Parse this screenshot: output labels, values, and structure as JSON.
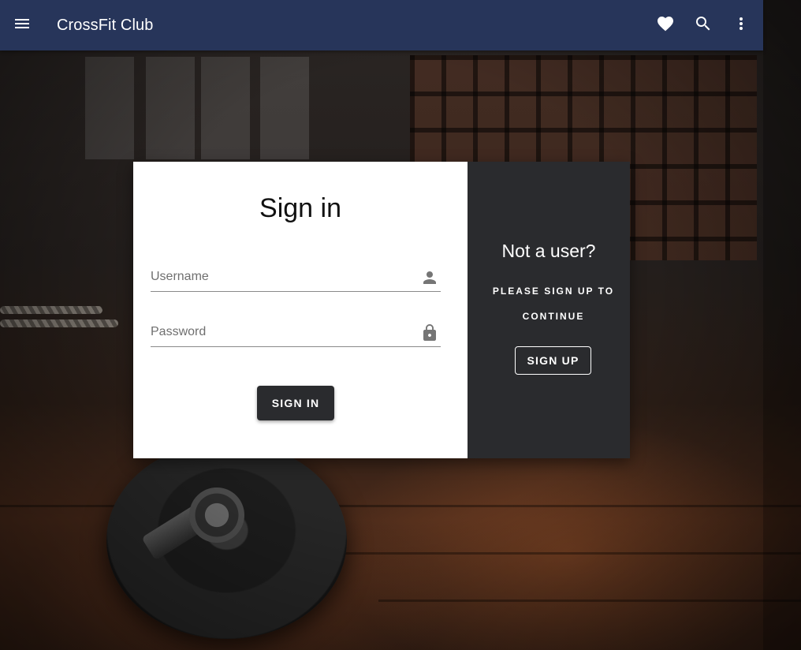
{
  "appbar": {
    "title": "CrossFit Club",
    "background_color": "#27355a",
    "menu_icon": "menu-icon",
    "actions": [
      {
        "icon": "heart-icon"
      },
      {
        "icon": "search-icon"
      },
      {
        "icon": "more-vert-icon"
      }
    ]
  },
  "signin": {
    "title": "Sign in",
    "username_placeholder": "Username",
    "username_value": "",
    "username_icon": "person-icon",
    "password_placeholder": "Password",
    "password_value": "",
    "password_icon": "lock-icon",
    "button_label": "SIGN IN"
  },
  "signup_panel": {
    "title": "Not a user?",
    "message": "PLEASE SIGN UP TO CONTINUE",
    "button_label": "SIGN UP",
    "background_color": "#2a2b2e"
  }
}
